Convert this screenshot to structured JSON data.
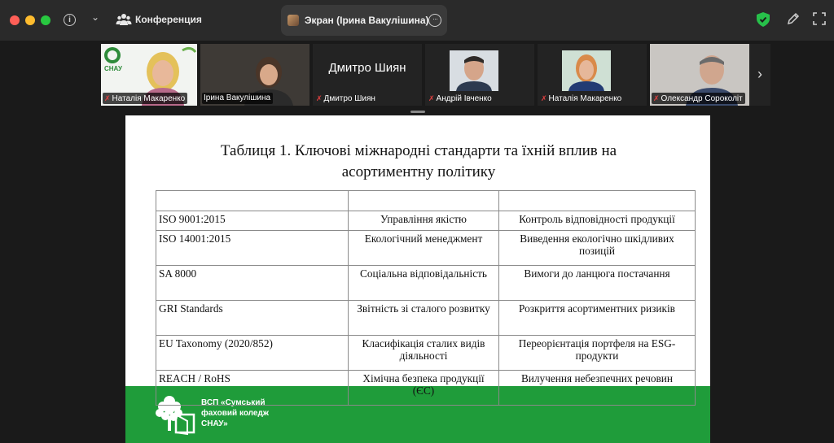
{
  "window": {
    "meeting_label": "Конференция",
    "share_tab_label": "Экран (Ірина Вакулішина)",
    "colors": {
      "titlebar": "#2a2a2a",
      "active_speaker": "#2ec04a",
      "slide_footer": "#1f9c3a"
    }
  },
  "participants": [
    {
      "name": "Наталія Макаренко",
      "muted": true,
      "logo_text": "СНАУ"
    },
    {
      "name": "Ірина Вакулішина",
      "muted": false,
      "active": true
    },
    {
      "name": "Дмитро Шиян",
      "muted": true,
      "camera_off_name": "Дмитро Шиян"
    },
    {
      "name": "Андрій Івченко",
      "muted": true
    },
    {
      "name": "Наталія Макаренко",
      "muted": true
    },
    {
      "name": "Олександр Сороколіт",
      "muted": true
    }
  ],
  "slide": {
    "title_line1": "Таблиця 1. Ключові міжнародні стандарти та їхній вплив на",
    "title_line2": "асортиментну політику",
    "table": {
      "header": [
        "",
        "",
        ""
      ],
      "rows": [
        [
          "ISO 9001:2015",
          "Управління якістю",
          "Контроль відповідності продукції"
        ],
        [
          "ISO 14001:2015",
          "Екологічний менеджмент",
          "Виведення екологічно шкідливих позицій"
        ],
        [
          "SA 8000",
          "Соціальна відповідальність",
          "Вимоги до ланцюга постачання"
        ],
        [
          "GRI Standards",
          "Звітність зі сталого розвитку",
          "Розкриття асортиментних ризиків"
        ],
        [
          "EU Taxonomy (2020/852)",
          "Класифікація сталих видів діяльності",
          "Переорієнтація портфеля на ESG-продукти"
        ],
        [
          "REACH / RoHS",
          "Хімічна безпека продукції (ЄС)",
          "Вилучення небезпечних речовин"
        ]
      ]
    },
    "footer": {
      "line1": "ВСП «Сумський",
      "line2": "фаховий коледж",
      "line3": "СНАУ»"
    }
  }
}
